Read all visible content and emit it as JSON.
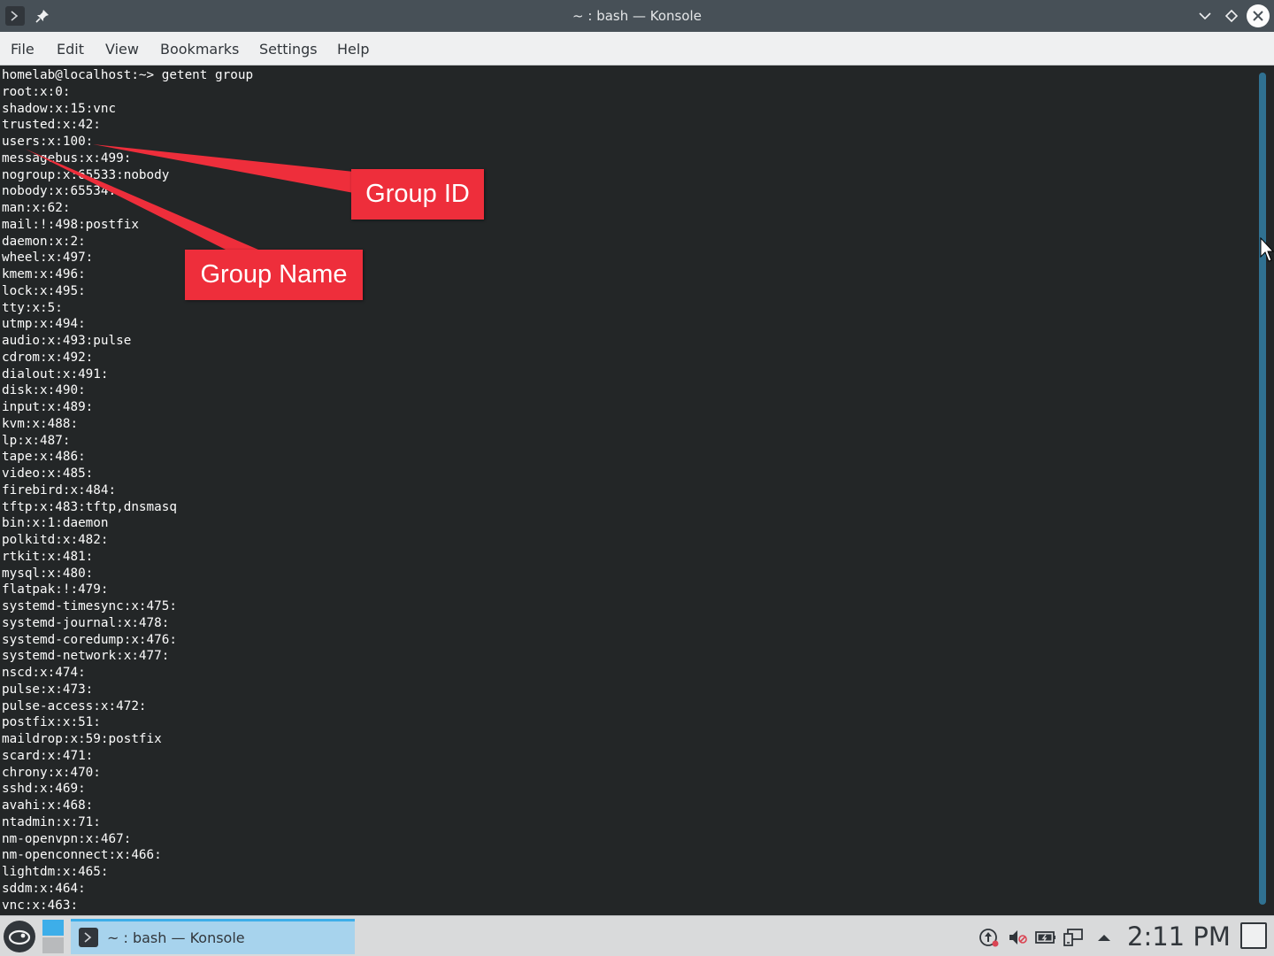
{
  "window": {
    "title": "~ : bash — Konsole",
    "colors": {
      "titlebar_bg": "#475057",
      "terminal_bg": "#232627",
      "accent": "#3daee9",
      "annotation": "#ee2e3b"
    }
  },
  "titlebar": {
    "icons": [
      "konsole-app-icon",
      "pin-icon",
      "minimize-chevron-icon",
      "maximize-diamond-icon",
      "close-icon"
    ]
  },
  "menubar": {
    "items": [
      {
        "label": "File"
      },
      {
        "label": "Edit"
      },
      {
        "label": "View"
      },
      {
        "label": "Bookmarks"
      },
      {
        "label": "Settings"
      },
      {
        "label": "Help"
      }
    ]
  },
  "terminal": {
    "lines": [
      "homelab@localhost:~> getent group",
      "root:x:0:",
      "shadow:x:15:vnc",
      "trusted:x:42:",
      "users:x:100:",
      "messagebus:x:499:",
      "nogroup:x:65533:nobody",
      "nobody:x:65534:",
      "man:x:62:",
      "mail:!:498:postfix",
      "daemon:x:2:",
      "wheel:x:497:",
      "kmem:x:496:",
      "lock:x:495:",
      "tty:x:5:",
      "utmp:x:494:",
      "audio:x:493:pulse",
      "cdrom:x:492:",
      "dialout:x:491:",
      "disk:x:490:",
      "input:x:489:",
      "kvm:x:488:",
      "lp:x:487:",
      "tape:x:486:",
      "video:x:485:",
      "firebird:x:484:",
      "tftp:x:483:tftp,dnsmasq",
      "bin:x:1:daemon",
      "polkitd:x:482:",
      "rtkit:x:481:",
      "mysql:x:480:",
      "flatpak:!:479:",
      "systemd-timesync:x:475:",
      "systemd-journal:x:478:",
      "systemd-coredump:x:476:",
      "systemd-network:x:477:",
      "nscd:x:474:",
      "pulse:x:473:",
      "pulse-access:x:472:",
      "postfix:x:51:",
      "maildrop:x:59:postfix",
      "scard:x:471:",
      "chrony:x:470:",
      "sshd:x:469:",
      "avahi:x:468:",
      "ntadmin:x:71:",
      "nm-openvpn:x:467:",
      "nm-openconnect:x:466:",
      "lightdm:x:465:",
      "sddm:x:464:",
      "vnc:x:463:"
    ]
  },
  "annotations": {
    "group_id": "Group ID",
    "group_name": "Group Name"
  },
  "taskbar": {
    "task_label": "~ : bash — Konsole",
    "clock": "2:11 PM",
    "tray_icons": [
      "update-icon",
      "volume-muted-icon",
      "battery-icon",
      "network-icon",
      "tray-expand-arrow-icon"
    ]
  }
}
